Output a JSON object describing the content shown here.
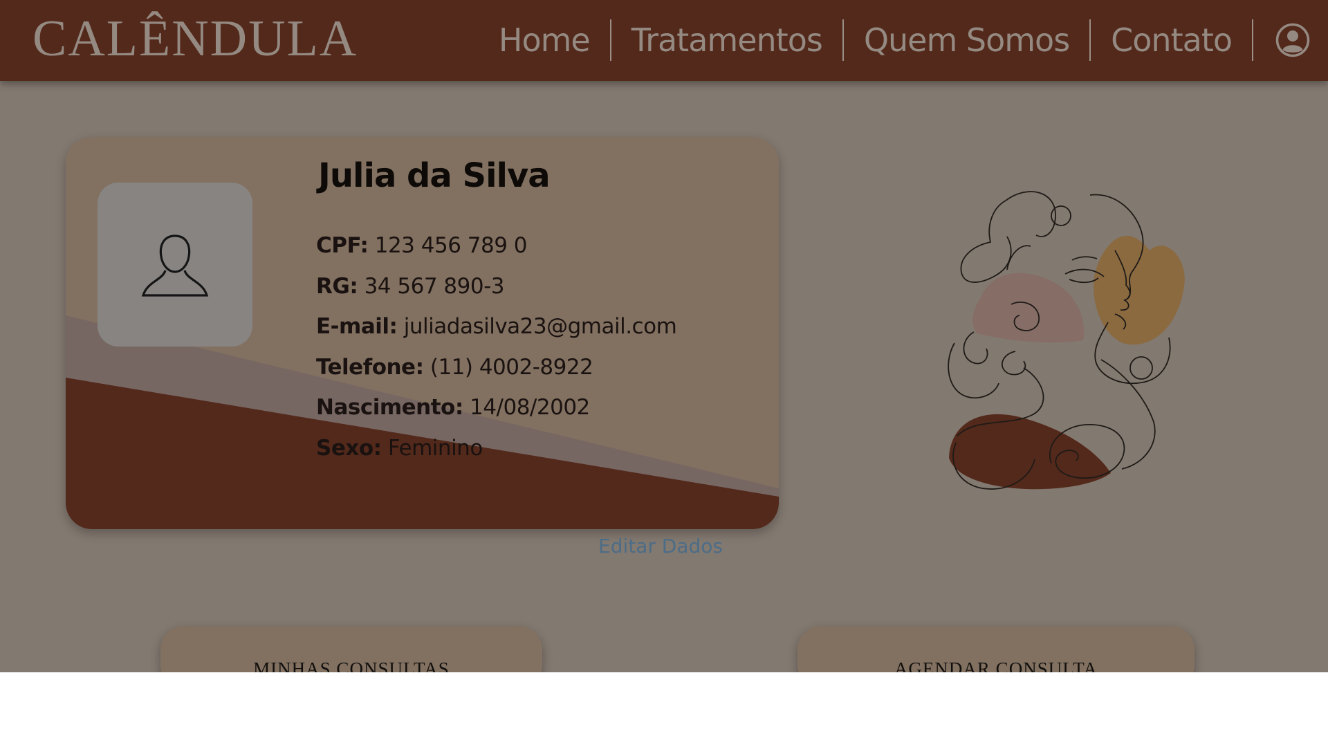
{
  "app": {
    "logo_text": "CALÊNDULA"
  },
  "nav": {
    "items": [
      {
        "label": "Home"
      },
      {
        "label": "Tratamentos"
      },
      {
        "label": "Quem Somos"
      },
      {
        "label": "Contato"
      }
    ],
    "account_icon": "user-circle-icon"
  },
  "profile": {
    "name": "Julia da Silva",
    "avatar_icon": "user-silhouette-icon",
    "fields": [
      {
        "label": "CPF:",
        "value": "123 456 789 0"
      },
      {
        "label": "RG:",
        "value": "34 567 890-3"
      },
      {
        "label": "E-mail:",
        "value": "juliadasilva23@gmail.com"
      },
      {
        "label": "Telefone:",
        "value": "(11) 4002-8922"
      },
      {
        "label": "Nascimento:",
        "value": "14/08/2002"
      },
      {
        "label": "Sexo:",
        "value": "Feminino"
      }
    ],
    "edit_label": "Editar Dados"
  },
  "actions": {
    "my_appointments": "MINHAS CONSULTAS",
    "schedule": "AGENDAR CONSULTA"
  },
  "colors": {
    "header": "#53291b",
    "overlay_bg": "#827970",
    "card": "#827161",
    "accent_brown": "#53291b",
    "accent_gold": "#8b6a40",
    "link": "#4c6c87"
  }
}
